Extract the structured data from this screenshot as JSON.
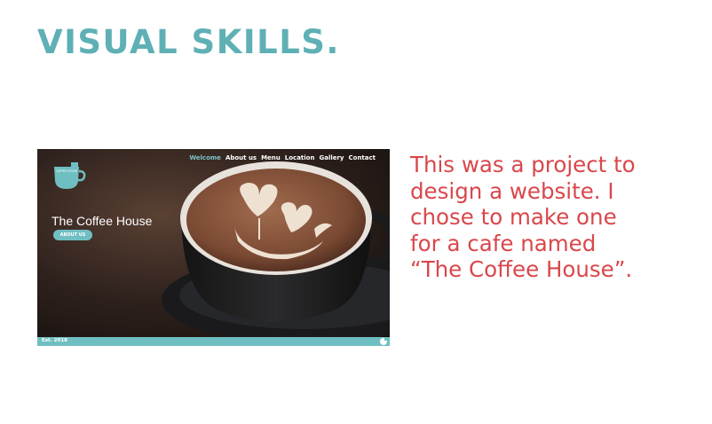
{
  "heading": "VISUAL SKILLS.",
  "mockup": {
    "nav": [
      "Welcome",
      "About us",
      "Menu",
      "Location",
      "Gallery",
      "Contact"
    ],
    "logo_text": "COFFEE HOUSE",
    "site_title": "The Coffee House",
    "button_label": "ABOUT US",
    "footer_text": "Est. 2018"
  },
  "description": [
    "This was a project to",
    "design a website. I",
    "chose to make one",
    "for a cafe named",
    "“The Coffee House”."
  ],
  "colors": {
    "heading": "#5fb0b5",
    "description": "#d9474b",
    "accent": "#6fbfc2"
  }
}
